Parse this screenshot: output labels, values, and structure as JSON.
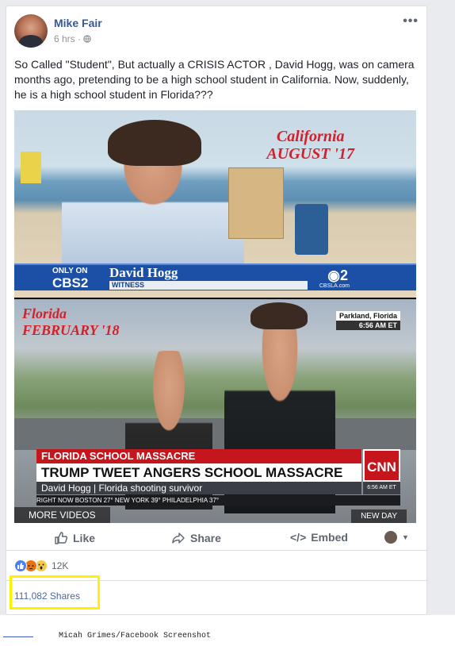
{
  "post": {
    "author": "Mike Fair",
    "time": "6 hrs",
    "text": "So Called \"Student\", But actually a CRISIS ACTOR , David Hogg, was on camera months ago, pretending to be a high school student in California. Now, suddenly, he is a high school student in Florida???"
  },
  "media": {
    "top": {
      "caption_line1": "California",
      "caption_line2": "AUGUST '17",
      "only_on": "ONLY ON",
      "network": "CBS2",
      "name": "David Hogg",
      "role": "WITNESS",
      "logo": "2",
      "url": "CBSLA.com"
    },
    "bottom": {
      "caption_line1": "Florida",
      "caption_line2": "FEBRUARY '18",
      "location": "Parkland, Florida",
      "time": "6:56 AM ET",
      "headline_small": "FLORIDA SCHOOL MASSACRE",
      "headline": "TRUMP TWEET ANGERS SCHOOL MASSACRE SURVIVORS",
      "person": "David Hogg",
      "person_desc": "Florida shooting survivor",
      "cnn_logo": "CNN",
      "cnn_time": "6:56 AM ET",
      "ticker": "RIGHT NOW   BOSTON  27°    NEW YORK  39°    PHILADELPHIA  37°",
      "more_videos": "MORE VIDEOS",
      "new_day": "NEW DAY"
    }
  },
  "actions": {
    "like": "Like",
    "share": "Share",
    "embed": "Embed"
  },
  "reactions": {
    "count": "12K",
    "icons": [
      "like-reaction",
      "angry-reaction",
      "wow-reaction"
    ]
  },
  "shares": "111,082 Shares",
  "footer": {
    "credit": "Micah Grimes/Facebook Screenshot"
  },
  "colors": {
    "link": "#365899",
    "highlight": "#fff200",
    "cbs_blue": "#1c4fa6",
    "cnn_red": "#c4161c"
  }
}
